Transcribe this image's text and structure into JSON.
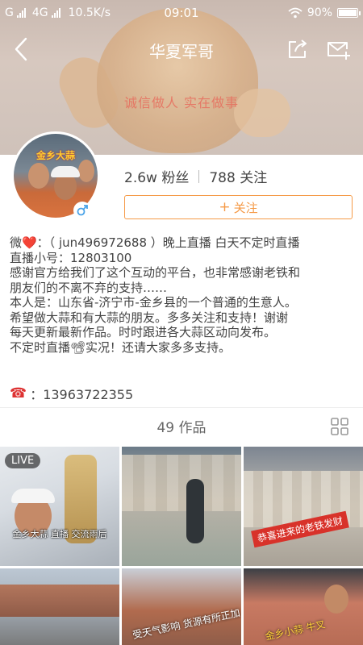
{
  "status_bar": {
    "carrier_left": "G",
    "network": "4G",
    "speed": "10.5K/s",
    "time": "09:01",
    "battery": "90%",
    "battery_level": 0.9
  },
  "header": {
    "title": "华夏军哥",
    "banner_slogan": "诚信做人 实在做事"
  },
  "profile": {
    "avatar_label": "金乡大蒜",
    "fans": "2.6w 粉丝",
    "following": "788 关注",
    "follow_label": "关注",
    "follow_icon": "+"
  },
  "bio": {
    "lines": [
      "微❤️：（ jun496972688 ）晚上直播 白天不定时直播",
      "直播小号：12803100",
      "感谢官方给我们了这个互动的平台，也非常感谢老铁和",
      "朋友们的不离不弃的支持……",
      "本人是：山东省-济宁市-金乡县的一个普通的生意人。",
      "希望做大蒜和有大蒜的朋友。多多关注和支持！谢谢",
      "每天更新最新作品。时时跟进各大蒜区动向发布。",
      "不定时直播📽实况！还请大家多多支持。"
    ],
    "phone_icon": "☎",
    "phone": "：13963722355"
  },
  "works": {
    "count_label": "49 作品"
  },
  "thumbnails": [
    {
      "badge": "LIVE",
      "caption": "金乡大蒜 直播 交流雨后"
    },
    {
      "caption": ""
    },
    {
      "caption": "恭喜进来的老铁发财"
    },
    {
      "caption": ""
    },
    {
      "caption": "受天气影响 货源有所正加"
    },
    {
      "caption": "金乡小蒜 牛叉"
    }
  ],
  "colors": {
    "accent": "#f59a47",
    "text": "#444444",
    "banner": "#d3c4bb"
  }
}
